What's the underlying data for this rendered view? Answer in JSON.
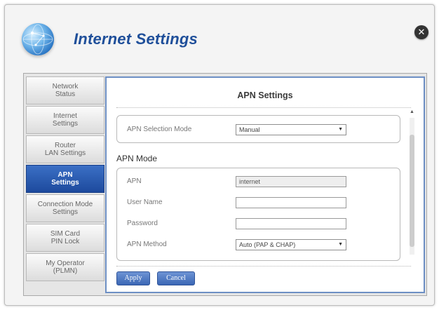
{
  "header": {
    "title": "Internet Settings",
    "close_symbol": "✕"
  },
  "sidebar": {
    "items": [
      {
        "line1": "Network",
        "line2": "Status"
      },
      {
        "line1": "Internet",
        "line2": "Settings"
      },
      {
        "line1": "Router",
        "line2": "LAN Settings"
      },
      {
        "line1": "APN",
        "line2": "Settings"
      },
      {
        "line1": "Connection Mode",
        "line2": "Settings"
      },
      {
        "line1": "SIM Card",
        "line2": "PIN Lock"
      },
      {
        "line1": "My Operator",
        "line2": "(PLMN)"
      }
    ],
    "active_index": 3
  },
  "main": {
    "title": "APN Settings",
    "selection_mode": {
      "label": "APN Selection Mode",
      "value": "Manual"
    },
    "apn_mode": {
      "heading": "APN Mode",
      "apn": {
        "label": "APN",
        "value": "internet"
      },
      "user_name": {
        "label": "User Name",
        "value": ""
      },
      "password": {
        "label": "Password",
        "value": ""
      },
      "method": {
        "label": "APN Method",
        "value": "Auto (PAP & CHAP)"
      }
    },
    "buttons": {
      "apply": "Apply",
      "cancel": "Cancel"
    }
  },
  "colors": {
    "accent": "#1f4f9a",
    "active_nav": "#2a5bb0",
    "panel_border": "#6d8fc4"
  },
  "icons": {
    "logo": "globe-icon",
    "close": "close-icon",
    "dropdown": "chevron-down-icon",
    "scroll_up": "arrow-up-icon"
  }
}
